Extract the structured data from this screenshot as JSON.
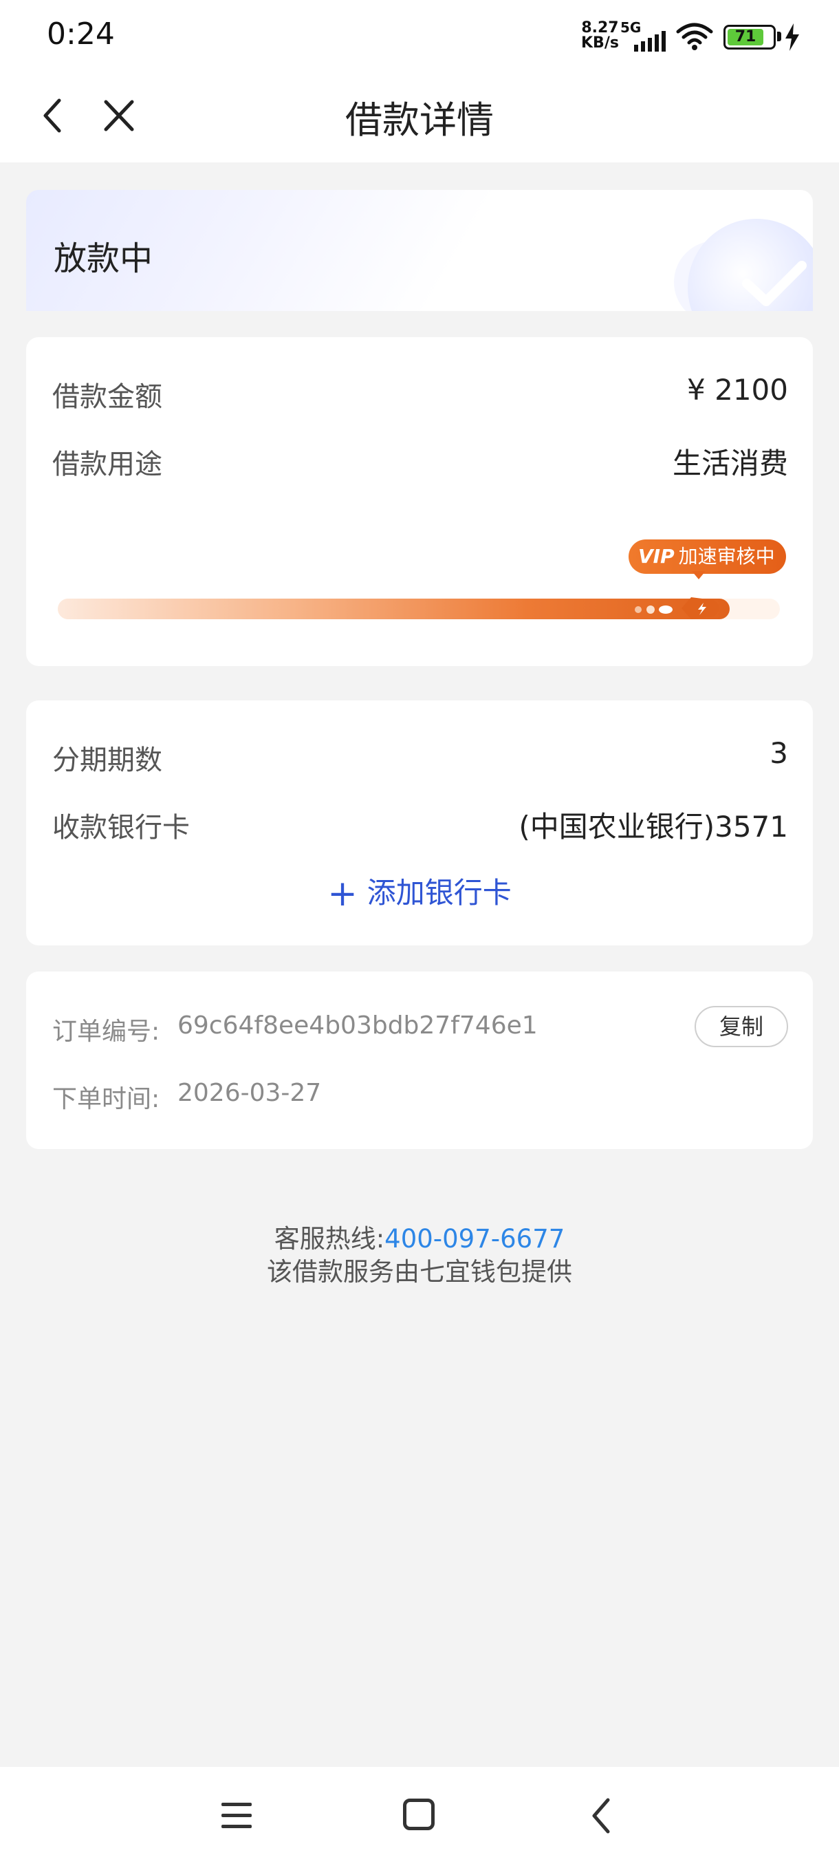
{
  "status_bar": {
    "time": "0:24",
    "net_speed_top": "8.27",
    "net_speed_bottom": "KB/s",
    "network_type": "5G",
    "battery": "71"
  },
  "nav": {
    "title": "借款详情"
  },
  "loan_status": {
    "text": "放款中"
  },
  "loan_info": {
    "amount_label": "借款金额",
    "amount_value": "¥ 2100",
    "purpose_label": "借款用途",
    "purpose_value": "生活消费",
    "badge_vip": "VIP",
    "badge_text": "加速审核中",
    "progress_fraction": 0.93
  },
  "installment": {
    "periods_label": "分期期数",
    "periods_value": "3",
    "card_label": "收款银行卡",
    "card_value": "(中国农业银行)3571",
    "add_card_plus": "+",
    "add_card_label": "添加银行卡"
  },
  "order": {
    "number_label": "订单编号:",
    "number_value": "69c64f8ee4b03bdb27f746e1",
    "copy_label": "复制",
    "time_label": "下单时间:",
    "time_value": "2026-03-27"
  },
  "footer": {
    "hotline_label": "客服热线:",
    "hotline_number": "400-097-6677",
    "provider_text": "该借款服务由七宜钱包提供"
  },
  "colors": {
    "accent_blue": "#2f55d4",
    "link_blue": "#2d86e6",
    "progress_orange": "#e0621c",
    "battery_green": "#5ec93a"
  },
  "icons": [
    "back-arrow-icon",
    "close-icon",
    "checkmark-icon",
    "rocket-icon",
    "wifi-icon",
    "signal-icon",
    "battery-icon",
    "charging-bolt-icon",
    "menu-icon",
    "home-icon",
    "system-back-icon"
  ]
}
